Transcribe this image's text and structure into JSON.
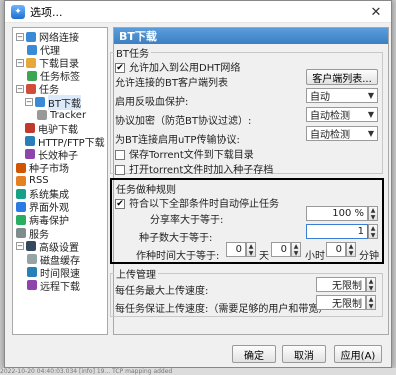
{
  "window": {
    "title": "选项...",
    "close_glyph": "✕"
  },
  "tree": {
    "items": [
      {
        "label": "网络连接",
        "icon": "network-icon",
        "color": "#3a8ad6"
      },
      {
        "label": "代理",
        "icon": "proxy-icon",
        "color": "#3a8ad6"
      },
      {
        "label": "下载目录",
        "icon": "folder-icon",
        "color": "#e7a73a"
      },
      {
        "label": "任务标签",
        "icon": "tag-icon",
        "color": "#3aa552"
      },
      {
        "label": "任务",
        "icon": "task-icon",
        "color": "#d24c3a"
      },
      {
        "label": "BT下载",
        "icon": "bt-icon",
        "color": "#3a8ad6"
      },
      {
        "label": "Tracker",
        "icon": "tracker-icon",
        "color": "#999999"
      },
      {
        "label": "电驴下载",
        "icon": "emule-icon",
        "color": "#c0392b"
      },
      {
        "label": "HTTP/FTP下载",
        "icon": "http-icon",
        "color": "#2980b9"
      },
      {
        "label": "长效种子",
        "icon": "seed-icon",
        "color": "#8e44ad"
      },
      {
        "label": "种子市场",
        "icon": "market-icon",
        "color": "#d35400"
      },
      {
        "label": "RSS",
        "icon": "rss-icon",
        "color": "#e67e22"
      },
      {
        "label": "系统集成",
        "icon": "integration-icon",
        "color": "#16a085"
      },
      {
        "label": "界面外观",
        "icon": "appearance-icon",
        "color": "#2c7be5"
      },
      {
        "label": "病毒保护",
        "icon": "shield-icon",
        "color": "#27ae60"
      },
      {
        "label": "服务",
        "icon": "service-icon",
        "color": "#7f8c8d"
      },
      {
        "label": "高级设置",
        "icon": "advanced-icon",
        "color": "#34495e"
      },
      {
        "label": "磁盘缓存",
        "icon": "disk-icon",
        "color": "#95a5a6"
      },
      {
        "label": "时间限速",
        "icon": "clock-icon",
        "color": "#2980b9"
      },
      {
        "label": "远程下载",
        "icon": "remote-icon",
        "color": "#8e44ad"
      }
    ]
  },
  "panel": {
    "header": "BT下载",
    "bt_group": {
      "title": "BT任务",
      "dht_label": "允许加入到公用DHT网络",
      "dht_checked": true,
      "clients_label": "允许连接的BT客户端列表",
      "clients_button": "客户端列表...",
      "anti_leech_label": "启用反吸血保护:",
      "anti_leech_value": "自动",
      "encryption_label": "协议加密（防范BT协议过滤）:",
      "encryption_value": "自动检测",
      "utp_label": "为BT连接启用uTP传输协议:",
      "utp_value": "自动检测",
      "save_torrent_label": "保存Torrent文件到下载目录",
      "save_torrent_checked": false,
      "open_torrent_label": "打开torrent文件时加入种子存档",
      "open_torrent_checked": false
    },
    "seeding_group": {
      "title": "任务做种规则",
      "auto_stop_label": "符合以下全部条件时自动停止任务",
      "auto_stop_checked": true,
      "ratio_label": "分享率大于等于:",
      "ratio_value": "100 %",
      "seeds_label": "种子数大于等于:",
      "seeds_value": "1",
      "time_label": "作种时间大于等于:",
      "days_value": "0",
      "days_unit": "天",
      "hours_value": "0",
      "hours_unit": "小时",
      "minutes_value": "0",
      "minutes_unit": "分钟"
    },
    "upload_group": {
      "title": "上传管理",
      "max_upload_label": "每任务最大上传速度:",
      "max_upload_value": "无限制",
      "guarantee_label": "每任务保证上传速度:（需要足够的用户和带宽）",
      "guarantee_value": "无限制"
    }
  },
  "footer": {
    "ok": "确定",
    "cancel": "取消",
    "apply": "应用(A)"
  },
  "status_strip": "2022-10-20 04:40:03.034   [info]   19...   TCP mapping added"
}
